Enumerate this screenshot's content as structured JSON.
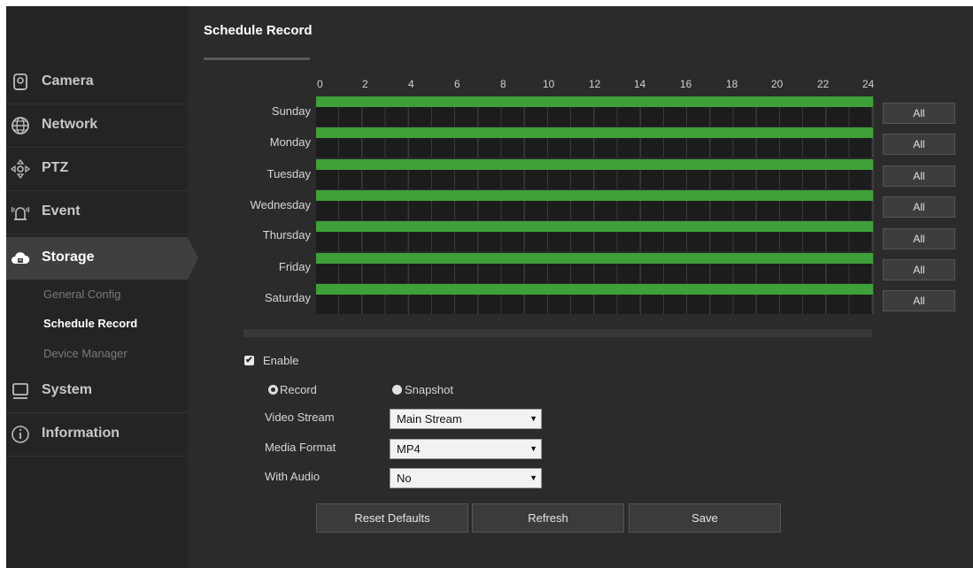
{
  "sidebar": {
    "items": [
      {
        "label": "Camera",
        "icon": "camera-icon"
      },
      {
        "label": "Network",
        "icon": "globe-icon"
      },
      {
        "label": "PTZ",
        "icon": "ptz-icon"
      },
      {
        "label": "Event",
        "icon": "alarm-icon"
      },
      {
        "label": "Storage",
        "icon": "cloud-icon",
        "active": true
      },
      {
        "label": "System",
        "icon": "monitor-icon"
      },
      {
        "label": "Information",
        "icon": "info-icon"
      }
    ],
    "storage_sub": [
      "General Config",
      "Schedule Record",
      "Device Manager"
    ]
  },
  "main": {
    "title": "Schedule Record",
    "schedule": {
      "hours": [
        "0",
        "2",
        "4",
        "6",
        "8",
        "10",
        "12",
        "14",
        "16",
        "18",
        "20",
        "22",
        "24"
      ],
      "days": [
        "Sunday",
        "Monday",
        "Tuesday",
        "Wednesday",
        "Thursday",
        "Friday",
        "Saturday"
      ],
      "all_label": "All",
      "coverage_fraction": 1.0
    },
    "form": {
      "enable_label": "Enable",
      "enable_checked": true,
      "record_label": "Record",
      "snapshot_label": "Snapshot",
      "record_selected": true,
      "video_stream_label": "Video Stream",
      "video_stream_value": "Main Stream",
      "media_format_label": "Media Format",
      "media_format_value": "MP4",
      "with_audio_label": "With Audio",
      "with_audio_value": "No"
    },
    "buttons": {
      "reset": "Reset Defaults",
      "refresh": "Refresh",
      "save": "Save"
    }
  },
  "colors": {
    "background": "#2b2b2b",
    "sidebar": "#242424",
    "schedule_green": "#3fa03a",
    "active_nav": "#3f3f3f"
  }
}
